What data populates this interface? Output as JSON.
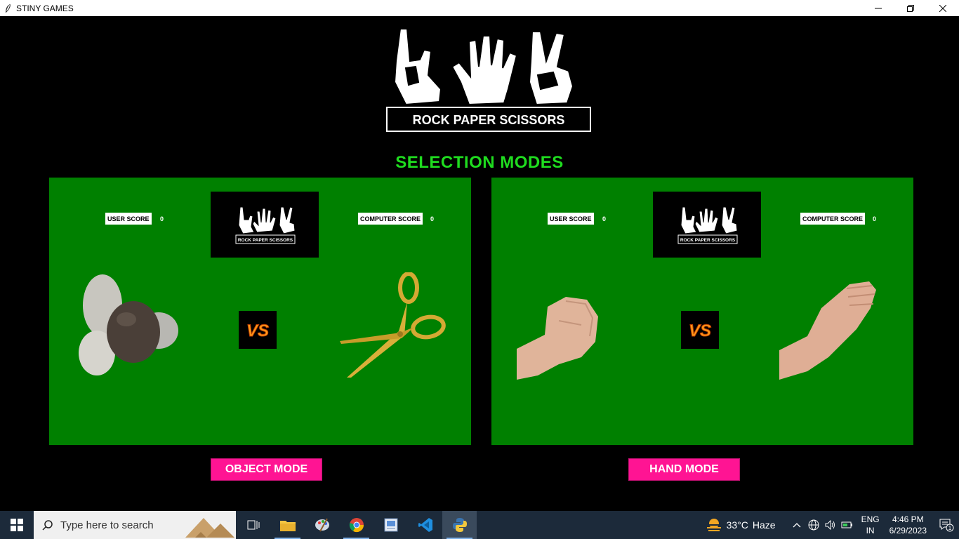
{
  "window": {
    "title": "STINY GAMES"
  },
  "logo": {
    "text": "ROCK PAPER SCISSORS"
  },
  "heading": "SELECTION MODES",
  "panels": [
    {
      "user_score_label": "USER SCORE",
      "user_score": "0",
      "computer_score_label": "COMPUTER SCORE",
      "computer_score": "0",
      "logo_text": "ROCK PAPER SCISSORS",
      "left_item": "rock",
      "right_item": "scissors",
      "button": "OBJECT MODE"
    },
    {
      "user_score_label": "USER SCORE",
      "user_score": "0",
      "computer_score_label": "COMPUTER SCORE",
      "computer_score": "0",
      "logo_text": "ROCK PAPER SCISSORS",
      "left_item": "fist",
      "right_item": "open-hand",
      "button": "HAND MODE"
    }
  ],
  "colors": {
    "panel_bg": "#008000",
    "heading": "#1fdc1f",
    "button_bg": "#ff1493"
  },
  "taskbar": {
    "search_placeholder": "Type here to search",
    "apps": [
      "task-view-icon",
      "file-explorer-icon",
      "paint-icon",
      "chrome-icon",
      "photos-icon",
      "vscode-icon",
      "python-icon"
    ],
    "weather_temp": "33°C",
    "weather_text": "Haze",
    "lang_line1": "ENG",
    "lang_line2": "IN",
    "time": "4:46 PM",
    "date": "6/29/2023",
    "notification_count": "1"
  }
}
